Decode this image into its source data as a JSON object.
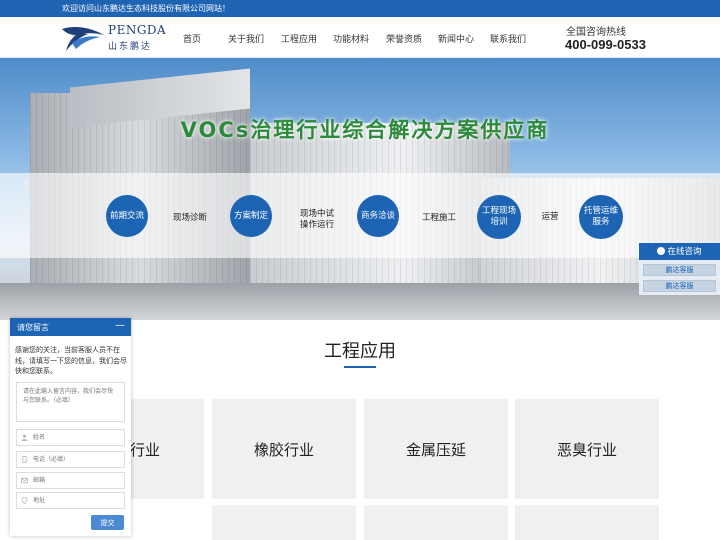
{
  "topbar": {
    "welcome": "欢迎访问山东鹏达生态科技股份有限公司网站！"
  },
  "header": {
    "logo_en": "PENGDA",
    "logo_cn": "山东鹏达",
    "nav": [
      "首页",
      "关于我们",
      "工程应用",
      "功能材料",
      "荣誉资质",
      "新闻中心",
      "联系我们"
    ],
    "hotline_label": "全国咨询热线",
    "hotline_number": "400-099-0533"
  },
  "banner": {
    "title": "VOCs治理行业综合解决方案供应商",
    "steps": [
      "前期交流",
      "现场诊断",
      "方案制定",
      "现场中试\n操作运行",
      "商务洽谈",
      "工程施工",
      "工程现场\n培训",
      "运营",
      "托管运维\n服务"
    ]
  },
  "consult": {
    "title": "在线咨询",
    "buttons": [
      "鹏达客服",
      "鹏达客服"
    ]
  },
  "section": {
    "title": "工程应用",
    "cards": [
      "行业",
      "橡胶行业",
      "金属压延",
      "恶臭行业"
    ]
  },
  "message": {
    "title": "请您留言",
    "minimize": "—",
    "description": "感谢您的关注，当前客服人员不在线，请填写一下您的信息，我们会尽快和您联系。",
    "textarea_placeholder": "请在此输入留言内容，我们会尽快与您联系。（必填）",
    "fields": [
      {
        "placeholder": "姓名",
        "icon": "user-icon"
      },
      {
        "placeholder": "电话（必填）",
        "icon": "phone-icon"
      },
      {
        "placeholder": "邮箱",
        "icon": "mail-icon"
      },
      {
        "placeholder": "地址",
        "icon": "location-icon"
      }
    ],
    "submit": "提交"
  },
  "colors": {
    "brand": "#1d64b5",
    "topbar": "#1f63b3",
    "title_green": "#2c8a3a"
  }
}
